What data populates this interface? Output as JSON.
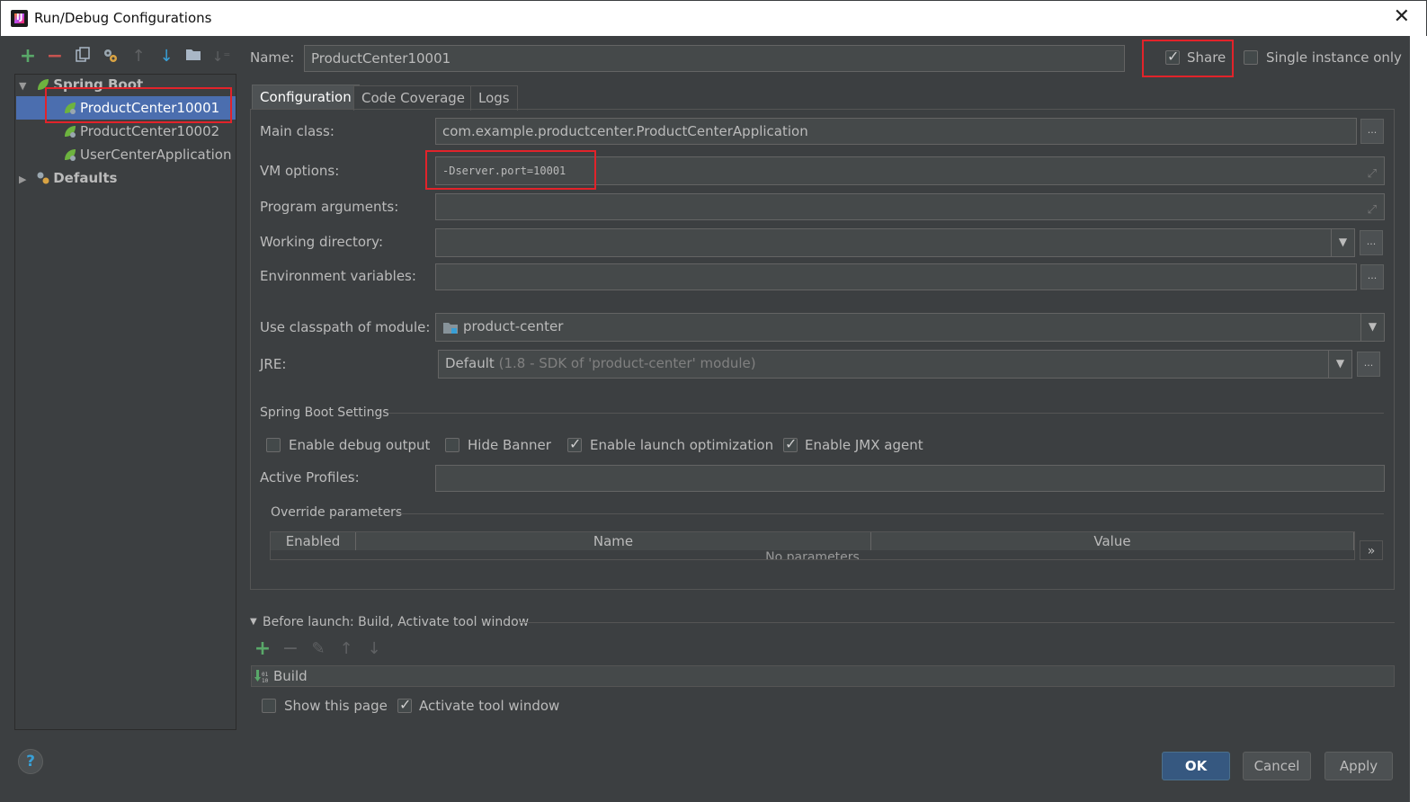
{
  "window": {
    "title": "Run/Debug Configurations",
    "app_icon_text": "IJ"
  },
  "toolbar": {
    "icons": [
      "add-icon",
      "remove-icon",
      "copy-icon",
      "edit-defaults-icon",
      "move-up-icon",
      "move-down-icon",
      "folder-icon",
      "sort-icon"
    ]
  },
  "tree": {
    "root_label": "Spring Boot",
    "items": [
      {
        "label": "ProductCenter10001",
        "selected": true
      },
      {
        "label": "ProductCenter10002",
        "selected": false
      },
      {
        "label": "UserCenterApplication",
        "selected": false
      }
    ],
    "defaults_label": "Defaults"
  },
  "name": {
    "label": "Name:",
    "value": "ProductCenter10001"
  },
  "share": {
    "label": "Share",
    "checked": true
  },
  "single_instance": {
    "label": "Single instance only",
    "checked": false
  },
  "tabs": [
    {
      "label": "Configuration",
      "active": true
    },
    {
      "label": "Code Coverage",
      "active": false
    },
    {
      "label": "Logs",
      "active": false
    }
  ],
  "config": {
    "main_class_label": "Main class:",
    "main_class_value": "com.example.productcenter.ProductCenterApplication",
    "vm_options_label": "VM options:",
    "vm_options_value": "-Dserver.port=10001",
    "program_args_label": "Program arguments:",
    "program_args_value": "",
    "working_dir_label": "Working directory:",
    "working_dir_value": "",
    "env_vars_label": "Environment variables:",
    "env_vars_value": "",
    "classpath_label": "Use classpath of module:",
    "classpath_value": "product-center",
    "jre_label": "JRE:",
    "jre_value": "Default",
    "jre_hint": "(1.8 - SDK of 'product-center' module)",
    "dots": "..."
  },
  "spring_boot_settings": {
    "title": "Spring Boot Settings",
    "options": [
      {
        "label": "Enable debug output",
        "checked": false
      },
      {
        "label": "Hide Banner",
        "checked": false
      },
      {
        "label": "Enable launch optimization",
        "checked": true
      },
      {
        "label": "Enable JMX agent",
        "checked": true
      }
    ],
    "active_profiles_label": "Active Profiles:",
    "active_profiles_value": ""
  },
  "override": {
    "title": "Override parameters",
    "columns": [
      "Enabled",
      "Name",
      "Value"
    ],
    "empty_text": "No parameters",
    "expand": "»"
  },
  "before_launch": {
    "title": "Before launch: Build, Activate tool window",
    "tasks": [
      "Build"
    ],
    "show_page": {
      "label": "Show this page",
      "checked": false
    },
    "activate_tool": {
      "label": "Activate tool window",
      "checked": true
    }
  },
  "buttons": {
    "help": "?",
    "ok": "OK",
    "cancel": "Cancel",
    "apply": "Apply"
  },
  "colors": {
    "background": "#3c3f41",
    "selection": "#4b6eaf",
    "highlight_box": "#e2232a",
    "primary_button": "#365880"
  }
}
